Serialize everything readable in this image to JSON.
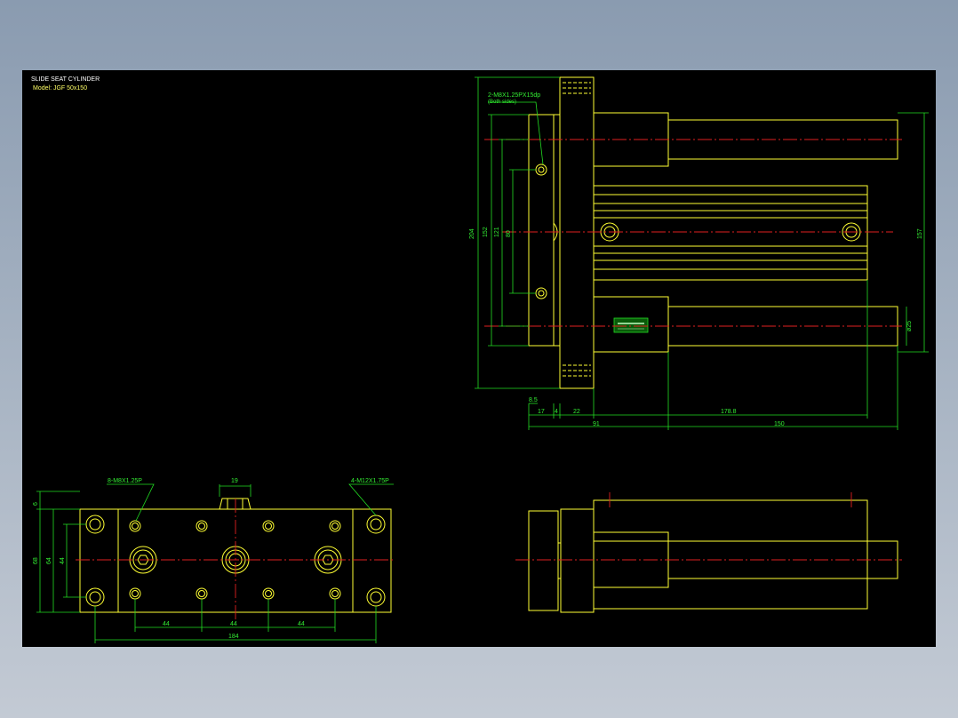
{
  "title_block": {
    "title": "SLIDE SEAT CYLINDER",
    "model": "Model: JGF 50x150"
  },
  "top_view": {
    "port_note_1": "2-M8X1.25PX15dp",
    "port_note_2": "(Both sides)",
    "dim_left_outer": "204",
    "dim_left_2": "152",
    "dim_left_3": "121",
    "dim_left_4": "80",
    "dim_right_height": "157",
    "dim_rod_dia": "ø25",
    "dim_small": "8.5",
    "dim_17": "17",
    "dim_4": "4",
    "dim_22": "22",
    "dim_178_8": "178.8",
    "dim_91": "91",
    "dim_150": "150"
  },
  "bottom_view": {
    "hole_note_left": "8-M8X1.25P",
    "hole_note_right": "4-M12X1.75P",
    "dim_top_19": "19",
    "dim_6": "6",
    "dim_68": "68",
    "dim_64": "64",
    "dim_44_v": "44",
    "dim_44_a": "44",
    "dim_44_b": "44",
    "dim_44_c": "44",
    "dim_184": "184"
  },
  "colors": {
    "background": "#000000",
    "outline": "#ffff33",
    "dimension": "#22dd22",
    "centerline": "#e02020",
    "text": "#ffffff"
  }
}
